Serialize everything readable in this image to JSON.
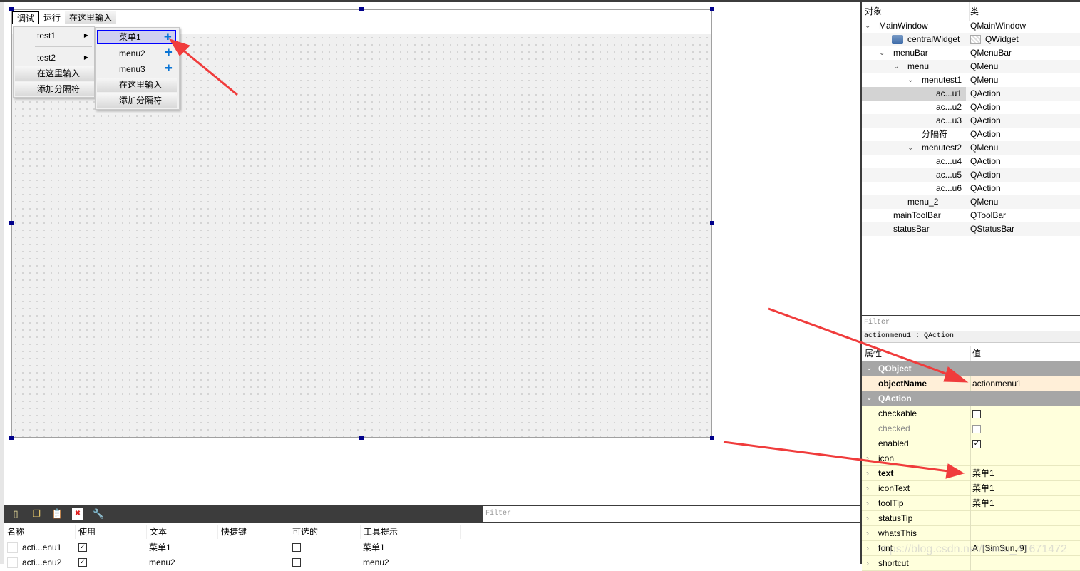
{
  "menubar": {
    "items": [
      "调试",
      "运行",
      "在这里输入"
    ]
  },
  "menu1": {
    "items": [
      "test1",
      "test2",
      "在这里输入",
      "添加分隔符"
    ]
  },
  "submenu": {
    "items": [
      "菜单1",
      "menu2",
      "menu3",
      "在这里输入",
      "添加分隔符"
    ]
  },
  "object_inspector": {
    "headers": {
      "object": "对象",
      "class": "类"
    },
    "rows": [
      {
        "name": "MainWindow",
        "cls": "QMainWindow",
        "level": 0,
        "expanded": true
      },
      {
        "name": "centralWidget",
        "cls": "QWidget",
        "level": 1,
        "icon": "widget-layout-broken-icon"
      },
      {
        "name": "menuBar",
        "cls": "QMenuBar",
        "level": 1,
        "expanded": true
      },
      {
        "name": "menu",
        "cls": "QMenu",
        "level": 2,
        "expanded": true
      },
      {
        "name": "menutest1",
        "cls": "QMenu",
        "level": 3,
        "expanded": true
      },
      {
        "name": "ac...u1",
        "cls": "QAction",
        "level": 4,
        "selected": true
      },
      {
        "name": "ac...u2",
        "cls": "QAction",
        "level": 4
      },
      {
        "name": "ac...u3",
        "cls": "QAction",
        "level": 4
      },
      {
        "name": "分隔符",
        "cls": "QAction",
        "level": 3
      },
      {
        "name": "menutest2",
        "cls": "QMenu",
        "level": 3,
        "expanded": true
      },
      {
        "name": "ac...u4",
        "cls": "QAction",
        "level": 4
      },
      {
        "name": "ac...u5",
        "cls": "QAction",
        "level": 4
      },
      {
        "name": "ac...u6",
        "cls": "QAction",
        "level": 4
      },
      {
        "name": "menu_2",
        "cls": "QMenu",
        "level": 2
      },
      {
        "name": "mainToolBar",
        "cls": "QToolBar",
        "level": 1
      },
      {
        "name": "statusBar",
        "cls": "QStatusBar",
        "level": 1
      }
    ]
  },
  "property_editor": {
    "filter_placeholder": "Filter",
    "object_label": "actionmenu1 : QAction",
    "headers": {
      "property": "属性",
      "value": "值"
    },
    "rows": [
      {
        "type": "group",
        "name": "QObject"
      },
      {
        "name": "objectName",
        "value": "actionmenu1",
        "bold": true,
        "highlight": true
      },
      {
        "type": "group",
        "name": "QAction"
      },
      {
        "name": "checkable",
        "checkbox": false
      },
      {
        "name": "checked",
        "checkbox": false,
        "disabled": true
      },
      {
        "name": "enabled",
        "checkbox": true
      },
      {
        "name": "icon",
        "value": "",
        "expandable": true
      },
      {
        "name": "text",
        "value": "菜单1",
        "bold": true,
        "expandable": true
      },
      {
        "name": "iconText",
        "value": "菜单1",
        "expandable": true
      },
      {
        "name": "toolTip",
        "value": "菜单1",
        "expandable": true
      },
      {
        "name": "statusTip",
        "value": "",
        "expandable": true
      },
      {
        "name": "whatsThis",
        "value": "",
        "expandable": true
      },
      {
        "name": "font",
        "value": "[SimSun, 9]",
        "font_icon": "A",
        "expandable": true
      },
      {
        "name": "shortcut",
        "value": "",
        "expandable": true
      }
    ]
  },
  "action_editor": {
    "toolbar_icons": [
      "new-action-icon",
      "copy-action-icon",
      "paste-action-icon",
      "delete-action-icon",
      "configure-wrench-icon"
    ],
    "filter_placeholder": "Filter",
    "headers": [
      "名称",
      "使用",
      "文本",
      "快捷键",
      "可选的",
      "工具提示"
    ],
    "rows": [
      {
        "name": "acti...enu1",
        "used": true,
        "text": "菜单1",
        "shortcut": "",
        "checkable": false,
        "tooltip": "菜单1"
      },
      {
        "name": "acti...enu2",
        "used": true,
        "text": "menu2",
        "shortcut": "",
        "checkable": false,
        "tooltip": "menu2"
      }
    ]
  },
  "watermark": "https://blog.csdn.net/baidu_41671472",
  "colors": {
    "arrow": "#f03c3c",
    "selection": "#0000ff",
    "group_header": "#a6a6a6",
    "property_bg": "#ffffdc"
  }
}
